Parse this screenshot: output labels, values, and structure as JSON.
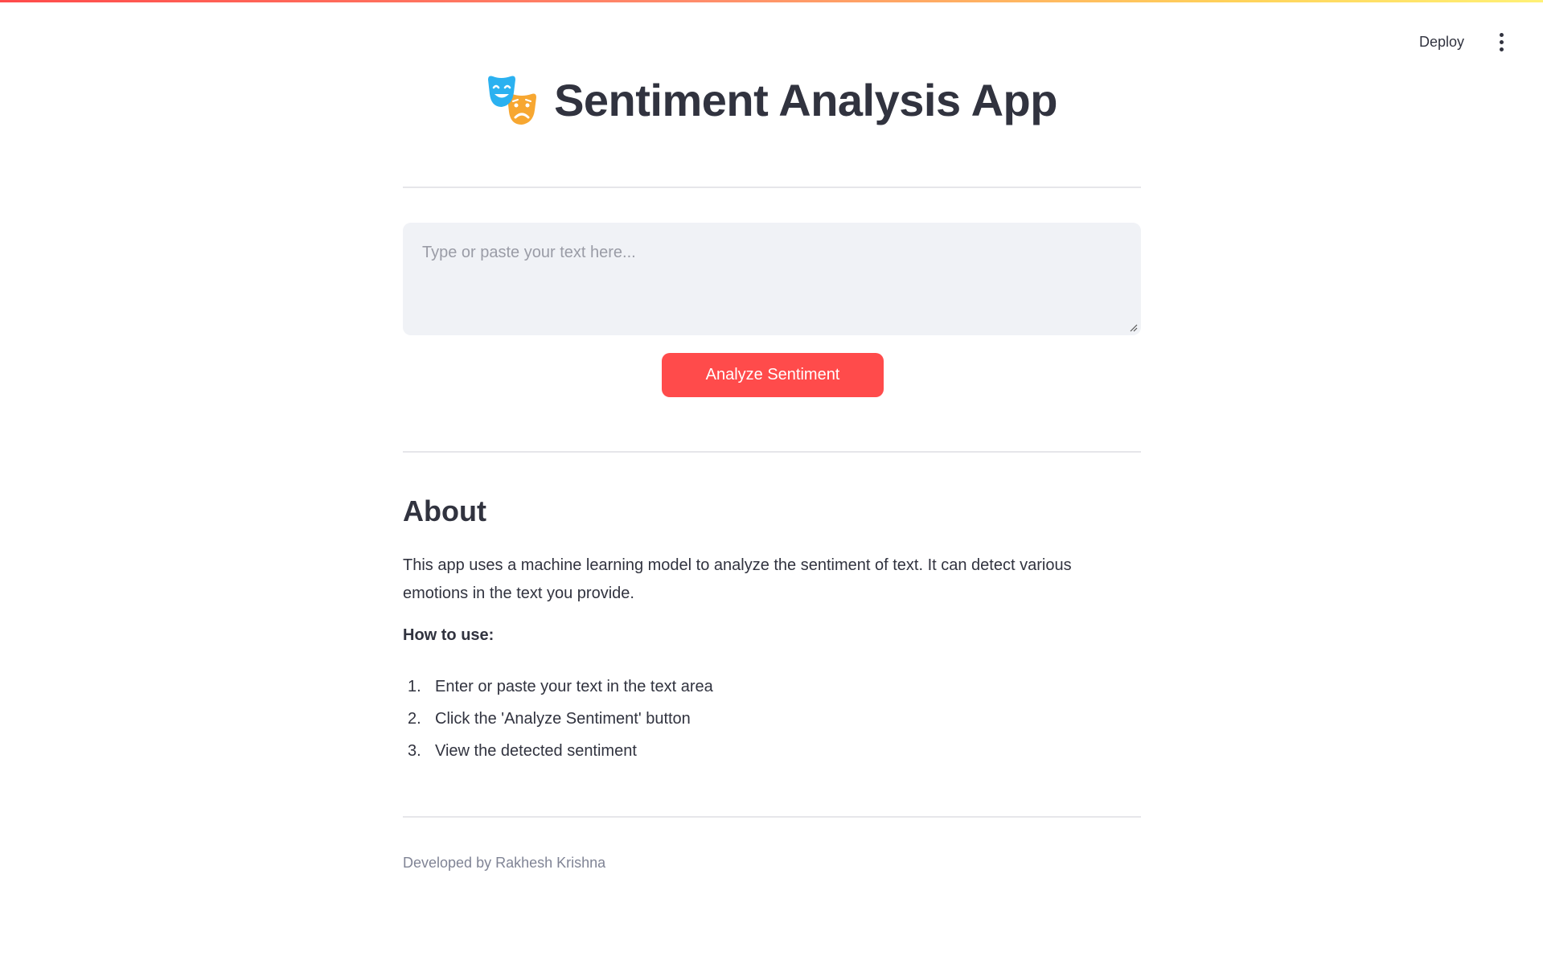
{
  "header": {
    "deploy_label": "Deploy",
    "menu_icon": "vertical-dots-icon"
  },
  "app": {
    "title": "Sentiment Analysis App",
    "title_icon": "performing-arts-masks-icon"
  },
  "input": {
    "value": "",
    "placeholder": "Type or paste your text here..."
  },
  "actions": {
    "analyze_label": "Analyze Sentiment"
  },
  "about": {
    "heading": "About",
    "description": "This app uses a machine learning model to analyze the sentiment of text. It can detect various emotions in the text you provide.",
    "howto_label": "How to use:",
    "steps": [
      {
        "num": "1.",
        "text": "Enter or paste your text in the text area"
      },
      {
        "num": "2.",
        "text": "Click the 'Analyze Sentiment' button"
      },
      {
        "num": "3.",
        "text": "View the detected sentiment"
      }
    ]
  },
  "footer": {
    "text": "Developed by Rakhesh Krishna"
  },
  "colors": {
    "accent": "#ff4b4b",
    "text": "#31333f",
    "input_bg": "#f0f2f6",
    "muted": "#808495"
  }
}
